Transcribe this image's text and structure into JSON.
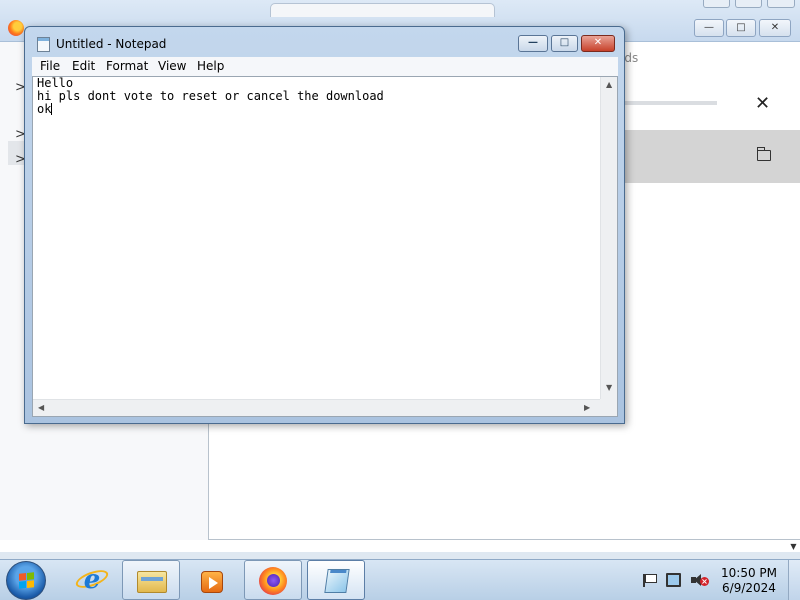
{
  "notepad": {
    "title": "Untitled - Notepad",
    "controls": {
      "minimize": "—",
      "maximize": "□",
      "close": "✕"
    },
    "menu": [
      "File",
      "Edit",
      "Format",
      "View",
      "Help"
    ],
    "content_lines": [
      "Hello",
      "hi pls dont vote to reset or cancel the download",
      "ok"
    ]
  },
  "firefox": {
    "partial_text": "ads",
    "downloads_close": "✕",
    "sidebar_chevrons": [
      ">",
      ">",
      ">"
    ]
  },
  "taskbar": {
    "apps": [
      "internet-explorer",
      "windows-explorer",
      "media-player",
      "firefox",
      "notepad"
    ],
    "clock": {
      "time": "10:50 PM",
      "date": "6/9/2024"
    }
  }
}
